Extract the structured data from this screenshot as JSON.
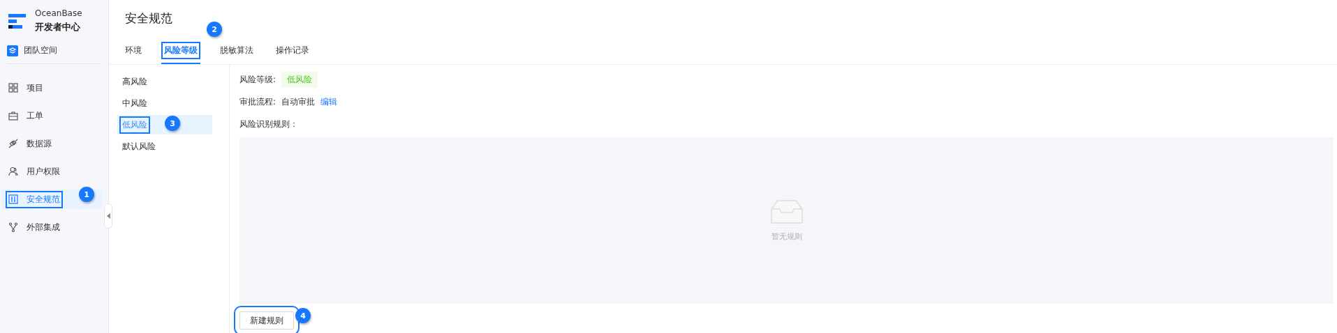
{
  "brand": {
    "name": "OceanBase",
    "subtitle": "开发者中心"
  },
  "workspace": {
    "label": "团队空间"
  },
  "sidebar": {
    "items": [
      {
        "label": "项目",
        "selected": false
      },
      {
        "label": "工单",
        "selected": false
      },
      {
        "label": "数据源",
        "selected": false
      },
      {
        "label": "用户权限",
        "selected": false
      },
      {
        "label": "安全规范",
        "selected": true
      },
      {
        "label": "外部集成",
        "selected": false
      }
    ]
  },
  "page": {
    "title": "安全规范"
  },
  "tabs": [
    {
      "label": "环境",
      "selected": false
    },
    {
      "label": "风险等级",
      "selected": true
    },
    {
      "label": "脱敏算法",
      "selected": false
    },
    {
      "label": "操作记录",
      "selected": false
    }
  ],
  "risk_levels": [
    {
      "label": "高风险",
      "selected": false
    },
    {
      "label": "中风险",
      "selected": false
    },
    {
      "label": "低风险",
      "selected": true
    },
    {
      "label": "默认风险",
      "selected": false
    }
  ],
  "detail": {
    "level_label": "风险等级:",
    "level_tag": "低风险",
    "approval_label": "审批流程:",
    "approval_value": "自动审批",
    "edit_link": "编辑",
    "rules_label": "风险识别规则：",
    "empty_text": "暂无规则",
    "new_button": "新建规则"
  },
  "annotations": [
    {
      "number": "1"
    },
    {
      "number": "2"
    },
    {
      "number": "3"
    },
    {
      "number": "4"
    }
  ]
}
